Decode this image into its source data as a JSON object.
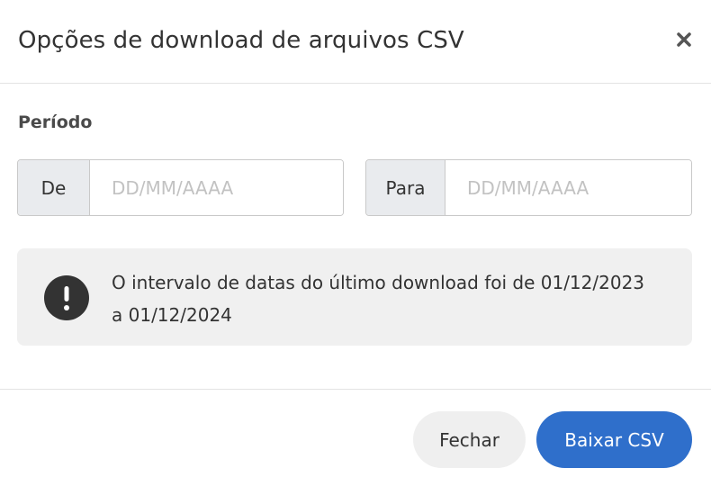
{
  "dialog": {
    "title": "Opções de download de arquivos CSV",
    "close_icon": "close-icon"
  },
  "period": {
    "label": "Período",
    "from": {
      "label": "De",
      "value": "",
      "placeholder": "DD/MM/AAAA"
    },
    "to": {
      "label": "Para",
      "value": "",
      "placeholder": "DD/MM/AAAA"
    }
  },
  "info": {
    "icon": "exclamation-icon",
    "message": "O intervalo de datas do último download foi de 01/12/2023 a 01/12/2024"
  },
  "footer": {
    "close_label": "Fechar",
    "download_label": "Baixar CSV"
  },
  "colors": {
    "primary": "#2f6fcb",
    "info_background": "#f0f0f0",
    "addon_background": "#e9ebee",
    "icon_dark": "#333333"
  }
}
